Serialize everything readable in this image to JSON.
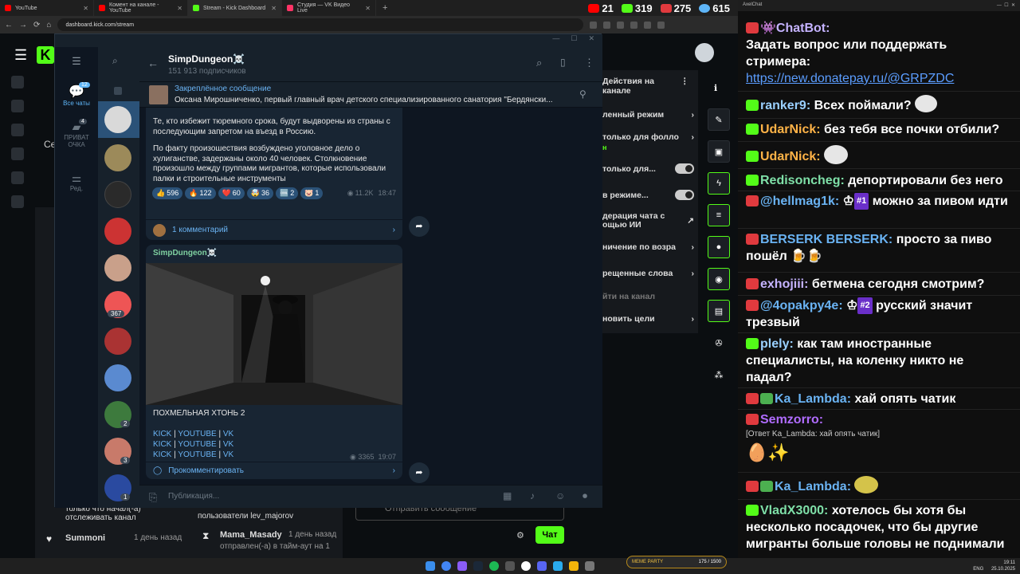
{
  "browser": {
    "tabs": [
      {
        "label": "YouTube",
        "color": "#ff0000"
      },
      {
        "label": "Комент на канале - YouTube",
        "color": "#ff0000"
      },
      {
        "label": "Stream - Kick Dashboard",
        "color": "#53fc18"
      },
      {
        "label": "Студия — VK Видео Live",
        "color": "#ff3366"
      }
    ],
    "new_tab": "+",
    "url": "dashboard.kick.com/stream",
    "stats": [
      {
        "value": "21",
        "color": "#ff0000"
      },
      {
        "value": "319",
        "color": "#53fc18"
      },
      {
        "value": "275",
        "color": "#e03a3e"
      },
      {
        "value": "615",
        "color": "#5eb5f7"
      }
    ]
  },
  "kick": {
    "logo": "K",
    "actions_title": "Действия на канале",
    "actions": [
      "ленный режим",
      "только для фолло",
      "только для...",
      "в режиме...",
      "дерация чата с ощью ИИ",
      "ничение по возра",
      "рещенные слова",
      "йти на канал",
      "новить цели"
    ],
    "actions_sub": "н",
    "left_text": "Се",
    "feed1": "только что начал(-а) отслеживать канал",
    "feed2_user": "Summoni",
    "feed2_time": "1 день назад",
    "mid1": "пользователи lev_majorov",
    "mid2_user": "Mama_Masady",
    "mid2_time": "1 день назад",
    "mid3": "отправлен(-а) в тайм-аут на 1",
    "chat_placeholder": "Отправить сообщение",
    "send": "Чат"
  },
  "telegram": {
    "folders": [
      {
        "label": "Все чаты",
        "badge": "12"
      },
      {
        "label": "ПРИВАТ ОЧКА",
        "badge": "4"
      },
      {
        "label": "Ред.",
        "badge": ""
      }
    ],
    "list_badges": [
      "367",
      "2",
      "3",
      "1"
    ],
    "channel_name": "SimpDungeon☠️",
    "subscribers": "151 913 подписчиков",
    "pinned_title": "Закреплённое сообщение",
    "pinned_text": "Оксана Мирошниченко, первый главный врач детского специализированного  санатория \"Бердянски...",
    "post1_text1": "Те, кто избежит тюремного срока, будут выдворены из страны с последующим запретом на въезд в Россию.",
    "post1_text2": "По факту произошествия возбуждено уголовное дело о хулиганстве, задержаны около 40 человек. Столкновение произошло между группами мигрантов, которые использовали палки и строительные инструменты",
    "reactions": [
      {
        "e": "👍",
        "n": "596"
      },
      {
        "e": "🔥",
        "n": "122"
      },
      {
        "e": "❤️",
        "n": "60"
      },
      {
        "e": "🤯",
        "n": "36"
      },
      {
        "e": "🆒",
        "n": "2"
      },
      {
        "e": "🐷",
        "n": "1"
      }
    ],
    "post1_views": "11.2K",
    "post1_time": "18:47",
    "post1_comments": "1 комментарий",
    "post2_author": "SimpDungeon☠️",
    "post2_title": "ПОХМЕЛЬНАЯ ХТОНЬ 2",
    "links": [
      "KICK",
      "YOUTUBE",
      "VK"
    ],
    "link_sep": "|",
    "post2_views": "3365",
    "post2_time": "19:07",
    "post2_comment": "Прокомментировать",
    "input_placeholder": "Публикация..."
  },
  "chat": {
    "title": "AxelChat",
    "messages": [
      {
        "p": "lv",
        "user": "ChatBot:",
        "ucolor": "#c5b3ff",
        "text": "Задать вопрос или поддержать стримера:",
        "link": "https://new.donatepay.ru/@GRPZDC"
      },
      {
        "p": "kk",
        "user": "ranker9:",
        "ucolor": "#9ad0ff",
        "text": "Всех поймали?"
      },
      {
        "p": "kk",
        "user": "UdarNick:",
        "ucolor": "#ffb347",
        "text": "без тебя все почки отбили?"
      },
      {
        "p": "kk",
        "user": "UdarNick:",
        "ucolor": "#ffb347",
        "text": ""
      },
      {
        "p": "kk",
        "user": "Redisoncheg:",
        "ucolor": "#7fe0a8",
        "text": "депортировали без него"
      },
      {
        "p": "yt",
        "user": "@hellmag1k:",
        "ucolor": "#6ab3f3",
        "badge": "#1",
        "text": "можно за пивом идти"
      },
      {
        "p": "lv",
        "user": "BERSERK BERSERK:",
        "ucolor": "#6ab3f3",
        "text": "просто за пиво пошёл 🍺🍺"
      },
      {
        "p": "lv",
        "user": "exhojiii:",
        "ucolor": "#c5b3ff",
        "text": "бетмена сегодня смотрим?"
      },
      {
        "p": "yt",
        "user": "@4opakpy4e:",
        "ucolor": "#6ab3f3",
        "badge": "#2",
        "text": "русский значит трезвый"
      },
      {
        "p": "kk",
        "user": "plely:",
        "ucolor": "#9ad0ff",
        "text": "как там иностранные специалисты, на коленку никто не падал?"
      },
      {
        "p": "lv",
        "user": "Ka_Lambda:",
        "ucolor": "#6ab3f3",
        "text": "хай опять чатик"
      },
      {
        "p": "lv",
        "user": "Semzorro:",
        "ucolor": "#b06cff",
        "text": ""
      },
      {
        "p": "lv",
        "user": "Ka_Lambda:",
        "ucolor": "#6ab3f3",
        "text": ""
      },
      {
        "p": "kk",
        "user": "VladX3000:",
        "ucolor": "#7fe0a8",
        "text": "хотелось бы хотя бы несколько посадочек, что бы другие мигранты больше головы не поднимали"
      }
    ],
    "reply_note": "[Ответ Ka_Lambda: хай опять чатик]"
  },
  "taskbar": {
    "lang": "ENG",
    "time": "19:11",
    "date": "25.10.2025",
    "party": "MEME PARTY",
    "party_count": "175 / 1500"
  }
}
